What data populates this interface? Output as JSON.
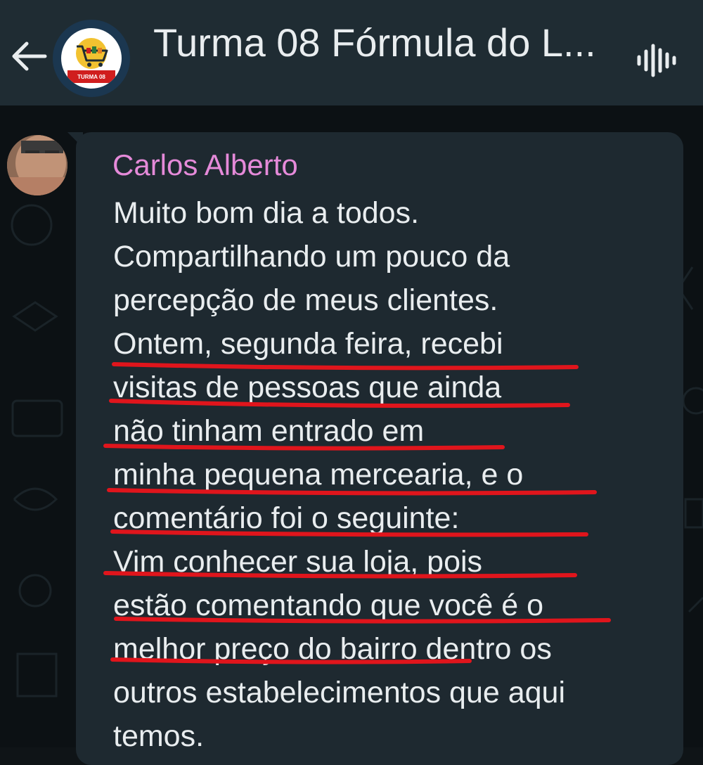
{
  "header": {
    "back_icon": "arrow-left-icon",
    "title": "Turma 08 Fórmula do L...",
    "avatar_badge": "TURMA 08",
    "voice_icon": "voice-chat-waveform-icon",
    "background_color": "#1f2c33"
  },
  "chat": {
    "background_color": "#0c1114",
    "message": {
      "sender": "Carlos Alberto",
      "sender_color": "#e58ad9",
      "lines": [
        "Muito bom dia a todos.",
        "Compartilhando um pouco da",
        "percepção de meus clientes.",
        "Ontem, segunda feira, recebi",
        "visitas de pessoas que ainda",
        "não tinham entrado em",
        "minha pequena mercearia, e o",
        "comentário foi o seguinte:",
        "Vim conhecer sua loja, pois",
        "estão comentando que você é o",
        "melhor preço do bairro dentro os",
        "outros estabelecimentos que aqui",
        "temos."
      ],
      "underline_color": "#e0151c",
      "underlined_line_count": 8
    }
  }
}
